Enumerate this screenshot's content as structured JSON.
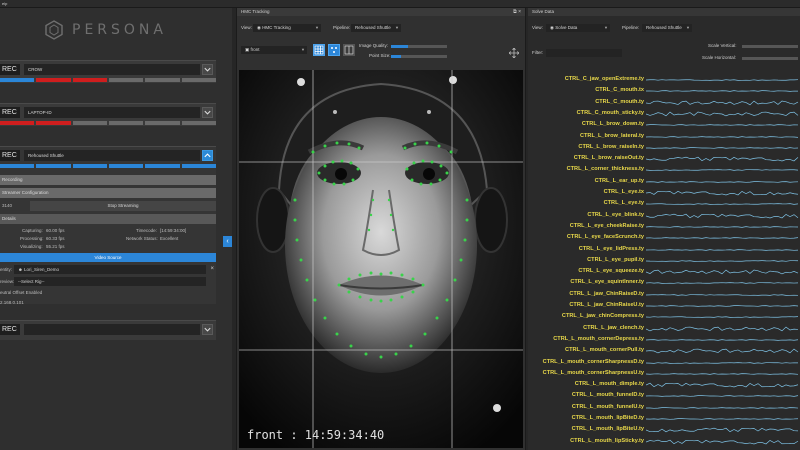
{
  "app": {
    "menu_label": "elp",
    "brand": "PERSONA"
  },
  "left_panel": {
    "cards": [
      {
        "rec_label": "REC",
        "name": "CROW",
        "bars": [
          "blue",
          "red",
          "red",
          "gray",
          "gray",
          "gray"
        ]
      },
      {
        "rec_label": "REC",
        "name": "LAPTOP-ID",
        "bars": [
          "red",
          "red",
          "gray",
          "gray",
          "gray",
          "gray"
        ]
      },
      {
        "rec_label": "REC",
        "name": "Rehoused Shuttle",
        "bars": [
          "blue",
          "blue",
          "blue",
          "blue",
          "blue",
          "blue"
        ]
      },
      {
        "rec_label": "REC",
        "name": ""
      }
    ],
    "recording_label": "Recording",
    "streamer_config_label": "Streamer Configuration",
    "port_value": "3140",
    "stop_streaming_label": "Stop Streaming",
    "details_label": "Details",
    "details": {
      "capturing_label": "Capturing:",
      "capturing_value": "60.00 fps",
      "processing_label": "Processing:",
      "processing_value": "60.33 fps",
      "visualizing_label": "Visualizing:",
      "visualizing_value": "55.21 fps",
      "timecode_label": "Timecode:",
      "timecode_value": "[14:59:34:00]",
      "network_label": "Network Status:",
      "network_value": "Excellent"
    },
    "video_source_label": "Video Source",
    "identity_label": "entity:",
    "identity_value": "Lori_Siren_Demo",
    "preview_label": "review:",
    "preview_value": "--Select Rig--",
    "neutral_label": "eutral Offset Enabled",
    "ip_value": "2.168.0.101"
  },
  "hmc_panel": {
    "title": "HMC Tracking",
    "view_label": "View:",
    "view_value": "HMC Tracking",
    "pipeline_label": "Pipeline:",
    "pipeline_value": "Rehoused Shuttle",
    "camera_value": "front",
    "image_quality_label": "Image Quality:",
    "image_quality": 0.3,
    "point_size_label": "Point Size:",
    "point_size": 0.18,
    "timestamp": "front : 14:59:34:40"
  },
  "solve_panel": {
    "title": "Solve Data",
    "view_label": "View:",
    "view_value": "Solve Data",
    "pipeline_label": "Pipeline:",
    "pipeline_value": "Rehoused Shuttle",
    "filter_label": "Filter:",
    "scale_vertical_label": "Scale Vertical:",
    "scale_horizontal_label": "Scale Horizontal:",
    "curves": [
      "CTRL_C_jaw_openExtreme.ty",
      "CTRL_C_mouth.tx",
      "CTRL_C_mouth.ty",
      "CTRL_C_mouth_sticky.ty",
      "CTRL_L_brow_down.ty",
      "CTRL_L_brow_lateral.ty",
      "CTRL_L_brow_raiseIn.ty",
      "CTRL_L_brow_raiseOut.ty",
      "CTRL_L_corner_thickness.ty",
      "CTRL_L_ear_up.ty",
      "CTRL_L_eye.tx",
      "CTRL_L_eye.ty",
      "CTRL_L_eye_blink.ty",
      "CTRL_L_eye_cheekRaise.ty",
      "CTRL_L_eye_faceScrunch.ty",
      "CTRL_L_eye_lidPress.ty",
      "CTRL_L_eye_pupil.ty",
      "CTRL_L_eye_squeeze.ty",
      "CTRL_L_eye_squintInner.ty",
      "CTRL_L_jaw_ChinRaiseD.ty",
      "CTRL_L_jaw_ChinRaiseU.ty",
      "CTRL_L_jaw_chinCompress.ty",
      "CTRL_L_jaw_clench.ty",
      "CTRL_L_mouth_cornerDepress.ty",
      "CTRL_L_mouth_cornerPull.ty",
      "CTRL_L_mouth_cornerSharpnessD.ty",
      "CTRL_L_mouth_cornerSharpnessU.ty",
      "CTRL_L_mouth_dimple.ty",
      "CTRL_L_mouth_funnelD.ty",
      "CTRL_L_mouth_funnelU.ty",
      "CTRL_L_mouth_lipBiteD.ty",
      "CTRL_L_mouth_lipBiteU.ty",
      "CTRL_L_mouth_lipSticky.ty"
    ]
  },
  "colors": {
    "accent": "#2c86d8",
    "curve_label": "#e8d84a",
    "curve_line": "#7fc3e6",
    "record_red": "#cf1e1e",
    "tracking_green": "#39d34a"
  }
}
